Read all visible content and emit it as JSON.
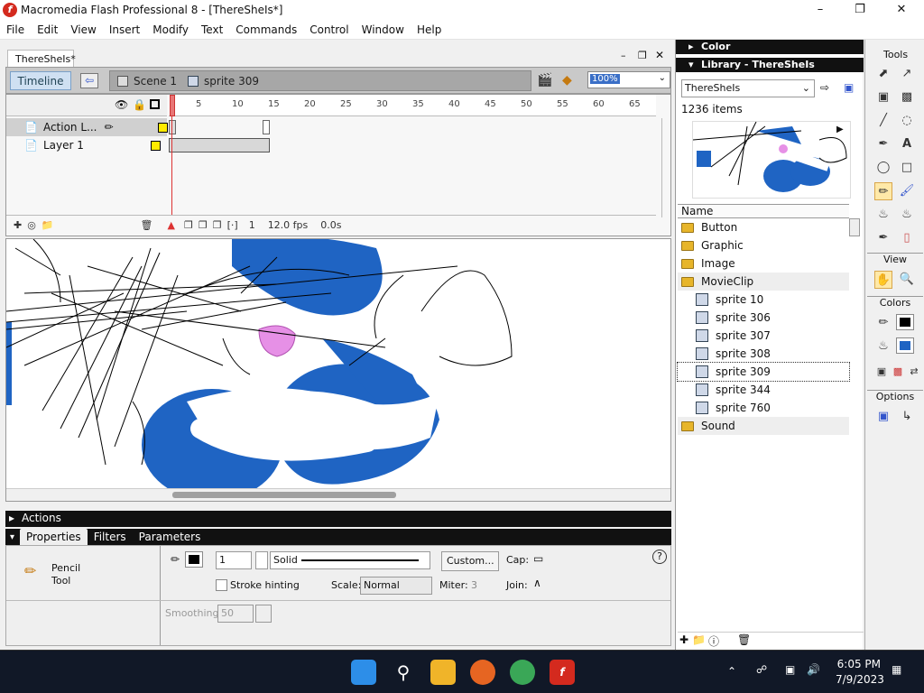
{
  "window": {
    "title": "Macromedia Flash Professional 8 - [ThereSheIs*]"
  },
  "menu": [
    "File",
    "Edit",
    "View",
    "Insert",
    "Modify",
    "Text",
    "Commands",
    "Control",
    "Window",
    "Help"
  ],
  "doc": {
    "tab": "ThereSheIs*"
  },
  "timeline_bar": {
    "timeline_button": "Timeline",
    "scene": "Scene 1",
    "symbol": "sprite 309",
    "zoom": "100%"
  },
  "timeline": {
    "ruler": [
      "5",
      "10",
      "15",
      "20",
      "25",
      "30",
      "35",
      "40",
      "45",
      "50",
      "55",
      "60",
      "65"
    ],
    "layers": [
      {
        "name": "Action L..."
      },
      {
        "name": "Layer 1"
      }
    ],
    "frame": "1",
    "fps": "12.0 fps",
    "time": "0.0s"
  },
  "panels": {
    "actions": "Actions",
    "tabs": [
      "Properties",
      "Filters",
      "Parameters"
    ]
  },
  "properties": {
    "tool_name": "Pencil",
    "tool_sub": "Tool",
    "stroke_width": "1",
    "stroke_style": "Solid",
    "custom_button": "Custom...",
    "cap_label": "Cap:",
    "stroke_hinting": "Stroke hinting",
    "scale_label": "Scale:",
    "scale_value": "Normal",
    "miter_label": "Miter:",
    "miter_value": "3",
    "join_label": "Join:",
    "smoothing_label": "Smoothing",
    "smoothing_value": "50"
  },
  "right": {
    "color_title": "Color",
    "library_title": "Library - ThereSheIs",
    "library_doc": "ThereSheIs",
    "count": "1236 items",
    "name_header": "Name",
    "items": [
      {
        "label": "Button",
        "kind": "folder"
      },
      {
        "label": "Graphic",
        "kind": "folder"
      },
      {
        "label": "Image",
        "kind": "folder"
      },
      {
        "label": "MovieClip",
        "kind": "folder"
      },
      {
        "label": "sprite 10",
        "kind": "sprite"
      },
      {
        "label": "sprite 306",
        "kind": "sprite"
      },
      {
        "label": "sprite 307",
        "kind": "sprite"
      },
      {
        "label": "sprite 308",
        "kind": "sprite"
      },
      {
        "label": "sprite 309",
        "kind": "sprite"
      },
      {
        "label": "sprite 344",
        "kind": "sprite"
      },
      {
        "label": "sprite 760",
        "kind": "sprite"
      },
      {
        "label": "Sound",
        "kind": "folder"
      }
    ]
  },
  "tools": {
    "title": "Tools",
    "view": "View",
    "colors": "Colors",
    "options": "Options"
  },
  "taskbar": {
    "time": "6:05 PM",
    "date": "7/9/2023"
  },
  "colors": {
    "stage_blue": "#1f64c3",
    "pink": "#e690e6",
    "stroke": "#000000",
    "fill": "#1f64c3"
  }
}
